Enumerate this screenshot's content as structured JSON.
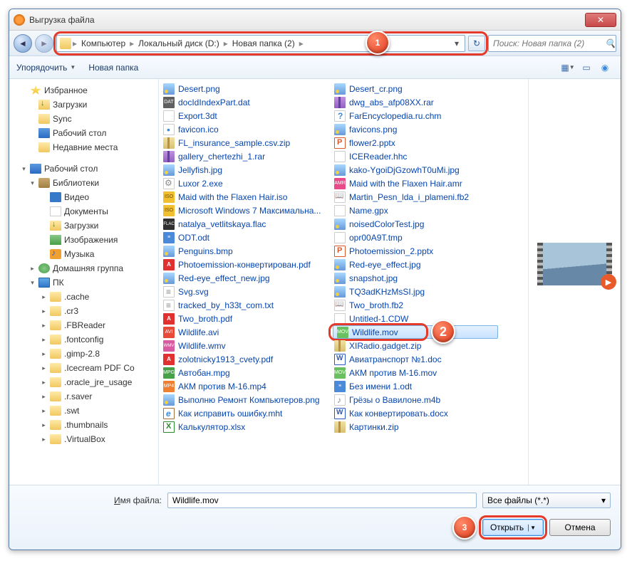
{
  "dialog": {
    "title": "Выгрузка файла",
    "close_x": "✕"
  },
  "nav": {
    "back": "◄",
    "forward": "►",
    "segments": [
      "Компьютер",
      "Локальный диск (D:)",
      "Новая папка (2)"
    ],
    "refresh": "↻",
    "search_placeholder": "Поиск: Новая папка (2)"
  },
  "toolbar": {
    "organize": "Упорядочить",
    "new_folder": "Новая папка"
  },
  "sidebar": {
    "favorites": "Избранное",
    "downloads": "Загрузки",
    "sync": "Sync",
    "desktop": "Рабочий стол",
    "recent": "Недавние места",
    "desktop2": "Рабочий стол",
    "libraries": "Библиотеки",
    "videos": "Видео",
    "documents": "Документы",
    "downloads2": "Загрузки",
    "pictures": "Изображения",
    "music": "Музыка",
    "homegroup": "Домашняя группа",
    "pc": "ПК",
    "folders": [
      ".cache",
      ".cr3",
      ".FBReader",
      ".fontconfig",
      ".gimp-2.8",
      ".Icecream PDF Co",
      ".oracle_jre_usage",
      ".r.saver",
      ".swt",
      ".thumbnails",
      ".VirtualBox"
    ]
  },
  "files": {
    "col1": [
      {
        "icon": "fi-img",
        "name": "Desert.png"
      },
      {
        "icon": "fi-dat",
        "name": "docIdIndexPart.dat"
      },
      {
        "icon": "fi-3d",
        "name": "Export.3dt"
      },
      {
        "icon": "fi-ico",
        "name": "favicon.ico"
      },
      {
        "icon": "fi-zip",
        "name": "FL_insurance_sample.csv.zip"
      },
      {
        "icon": "fi-rar",
        "name": "gallery_chertezhi_1.rar"
      },
      {
        "icon": "fi-img",
        "name": "Jellyfish.jpg"
      },
      {
        "icon": "fi-exe",
        "name": "Luxor 2.exe"
      },
      {
        "icon": "fi-iso",
        "name": "Maid with the Flaxen Hair.iso"
      },
      {
        "icon": "fi-iso",
        "name": "Microsoft Windows 7 Максимальна..."
      },
      {
        "icon": "fi-flac",
        "name": "natalya_vetlitskaya.flac"
      },
      {
        "icon": "fi-odt",
        "name": "ODT.odt"
      },
      {
        "icon": "fi-img",
        "name": "Penguins.bmp"
      },
      {
        "icon": "fi-pdf",
        "name": "Photoemission-конвертирован.pdf"
      },
      {
        "icon": "fi-img",
        "name": "Red-eye_effect_new.jpg"
      },
      {
        "icon": "fi-txt",
        "name": "Svg.svg"
      },
      {
        "icon": "fi-txt",
        "name": "tracked_by_h33t_com.txt"
      },
      {
        "icon": "fi-pdf",
        "name": "Two_broth.pdf"
      },
      {
        "icon": "fi-avi",
        "name": "Wildlife.avi"
      },
      {
        "icon": "fi-wmv",
        "name": "Wildlife.wmv"
      },
      {
        "icon": "fi-pdf",
        "name": "zolotnicky1913_cvety.pdf"
      },
      {
        "icon": "fi-mpg",
        "name": "Автобан.mpg"
      },
      {
        "icon": "fi-mp4",
        "name": "АКМ против М-16.mp4"
      },
      {
        "icon": "fi-img",
        "name": "Выполню Ремонт Компьютеров.png"
      },
      {
        "icon": "fi-mht",
        "name": "Как исправить ошибку.mht"
      },
      {
        "icon": "fi-xls",
        "name": "Калькулятор.xlsx"
      }
    ],
    "col2": [
      {
        "icon": "fi-img",
        "name": "Desert_cr.png"
      },
      {
        "icon": "fi-rar",
        "name": "dwg_abs_afp08XX.rar"
      },
      {
        "icon": "fi-chm",
        "name": "FarEncyclopedia.ru.chm"
      },
      {
        "icon": "fi-img",
        "name": "favicons.png"
      },
      {
        "icon": "fi-ppt",
        "name": "flower2.pptx"
      },
      {
        "icon": "fi-hhc",
        "name": "ICEReader.hhc"
      },
      {
        "icon": "fi-img",
        "name": "kako-YgoiDjGzowhT0uMi.jpg"
      },
      {
        "icon": "fi-amr",
        "name": "Maid with the Flaxen Hair.amr"
      },
      {
        "icon": "fi-fb2",
        "name": "Martin_Pesn_lda_i_plameni.fb2"
      },
      {
        "icon": "fi-gpx",
        "name": "Name.gpx"
      },
      {
        "icon": "fi-img",
        "name": "noisedColorTest.jpg"
      },
      {
        "icon": "fi-tmp",
        "name": "opr00A9T.tmp"
      },
      {
        "icon": "fi-ppt",
        "name": "Photoemission_2.pptx"
      },
      {
        "icon": "fi-img",
        "name": "Red-eye_effect.jpg"
      },
      {
        "icon": "fi-img",
        "name": "snapshot.jpg"
      },
      {
        "icon": "fi-img",
        "name": "TQ3adKHzMsSI.jpg"
      },
      {
        "icon": "fi-fb2",
        "name": "Two_broth.fb2"
      },
      {
        "icon": "fi-cdw",
        "name": "Untitled-1.CDW"
      },
      {
        "icon": "fi-mov",
        "name": "Wildlife.mov",
        "selected": true
      },
      {
        "icon": "fi-zip",
        "name": "XIRadio.gadget.zip"
      },
      {
        "icon": "fi-doc",
        "name": "Авиатранспорт №1.doc"
      },
      {
        "icon": "fi-mov",
        "name": "АКМ против М-16.mov"
      },
      {
        "icon": "fi-odt",
        "name": "Без имени 1.odt"
      },
      {
        "icon": "fi-m4b",
        "name": "Грёзы о Вавилоне.m4b"
      },
      {
        "icon": "fi-doc",
        "name": "Как конвертировать.docx"
      },
      {
        "icon": "fi-zip",
        "name": "Картинки.zip"
      }
    ]
  },
  "bottom": {
    "filename_label": "Имя файла:",
    "filename_value": "Wildlife.mov",
    "filetype": "Все файлы (*.*)",
    "open": "Открыть",
    "cancel": "Отмена"
  },
  "callouts": {
    "c1": "1",
    "c2": "2",
    "c3": "3"
  }
}
